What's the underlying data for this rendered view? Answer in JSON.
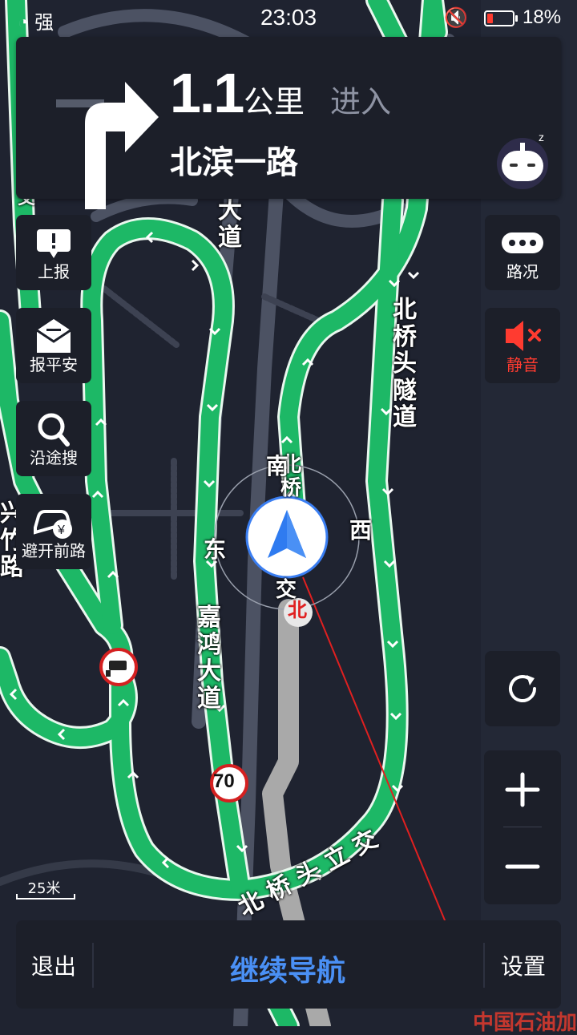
{
  "status_bar": {
    "signal": "强",
    "time": "23:03",
    "mute": "🔇",
    "battery": "18%"
  },
  "guidance": {
    "distance": "1.1",
    "unit": "公里",
    "action": "进入",
    "road": "北滨一路"
  },
  "left_buttons": [
    {
      "label": "上报",
      "icon": "report-icon"
    },
    {
      "label": "报平安",
      "icon": "safe-mail-icon"
    },
    {
      "label": "沿途搜",
      "icon": "search-icon"
    },
    {
      "label": "避开前路",
      "icon": "avoid-road-icon"
    }
  ],
  "right_buttons": [
    {
      "label": "路况",
      "icon": "traffic-icon"
    },
    {
      "label": "静音",
      "icon": "mute-speaker-icon",
      "color": "#ff3b30"
    }
  ],
  "compass": {
    "south": "南",
    "east": "东",
    "west": "西",
    "north": "北"
  },
  "map_labels": {
    "dadao_top": "大\n道",
    "beiqiao_tunnel": "北\n桥\n头\n隧\n道",
    "xing_left": "兴\n竹\n路",
    "jiahong": "嘉\n鸿\n大\n道",
    "nanbei_qiao": "北\n桥",
    "jiao": "交",
    "interchange": "北 桥 头 立 交",
    "top_left": "交",
    "poi_bottom": "中国石油加"
  },
  "speed_limit": "70",
  "scale": "25米",
  "bottom_bar": {
    "exit": "退出",
    "continue": "继续导航",
    "settings": "设置"
  },
  "colors": {
    "route": "#1db866",
    "route_border": "#e9f7ee",
    "map_bg": "#1f2330",
    "road": "#4c5263",
    "accent_blue": "#4a90f5",
    "mute_red": "#ff3b30"
  }
}
